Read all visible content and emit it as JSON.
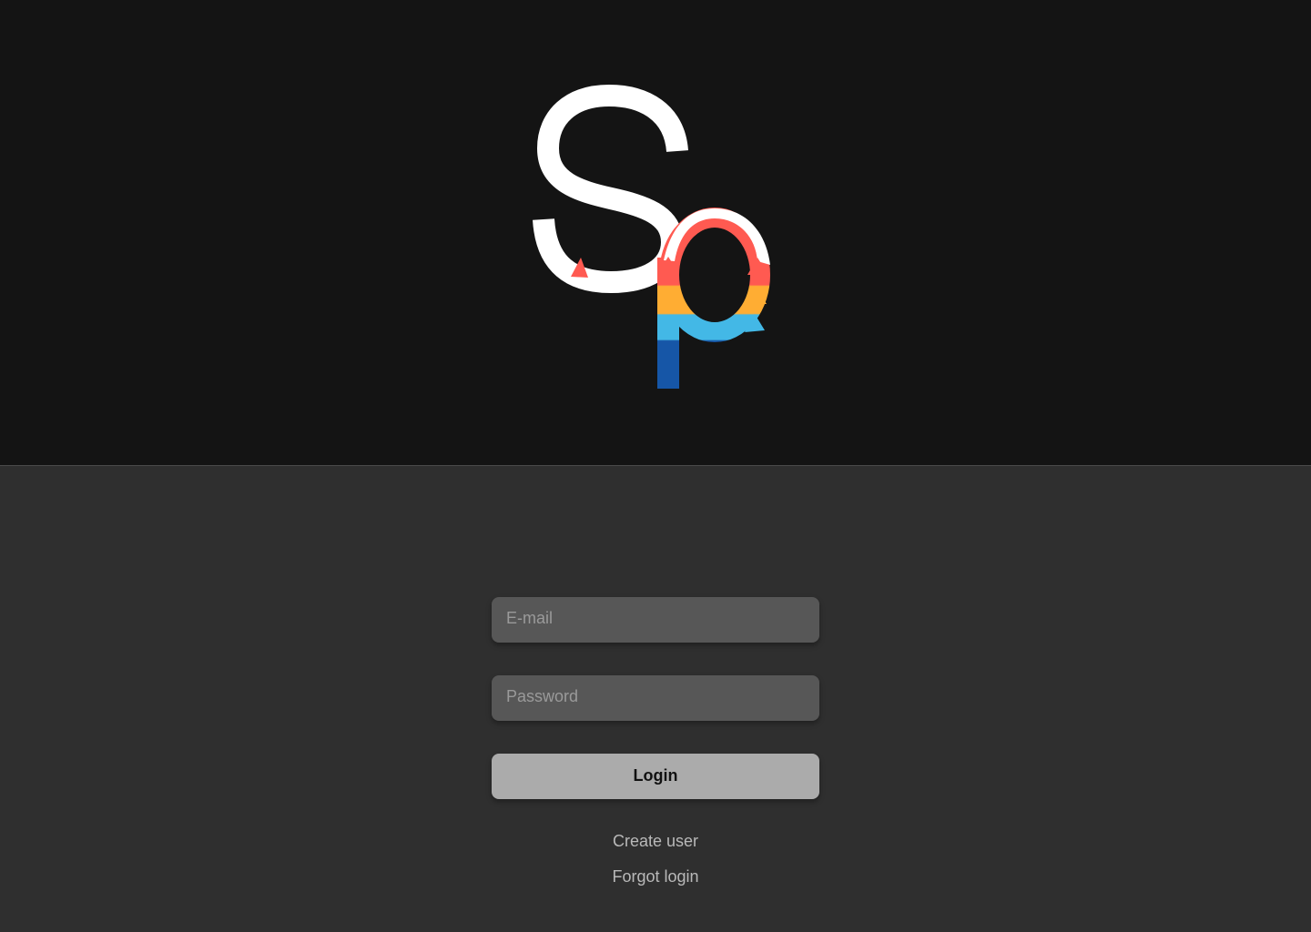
{
  "logo": {
    "text": "Sp",
    "colors": {
      "letter": "#ffffff",
      "red": "#ff5a51",
      "orange": "#ffad33",
      "light_blue": "#43b8e6",
      "dark_blue": "#1656a7"
    }
  },
  "login": {
    "email_placeholder": "E-mail",
    "password_placeholder": "Password",
    "button_label": "Login",
    "create_user_label": "Create user",
    "forgot_login_label": "Forgot login"
  }
}
